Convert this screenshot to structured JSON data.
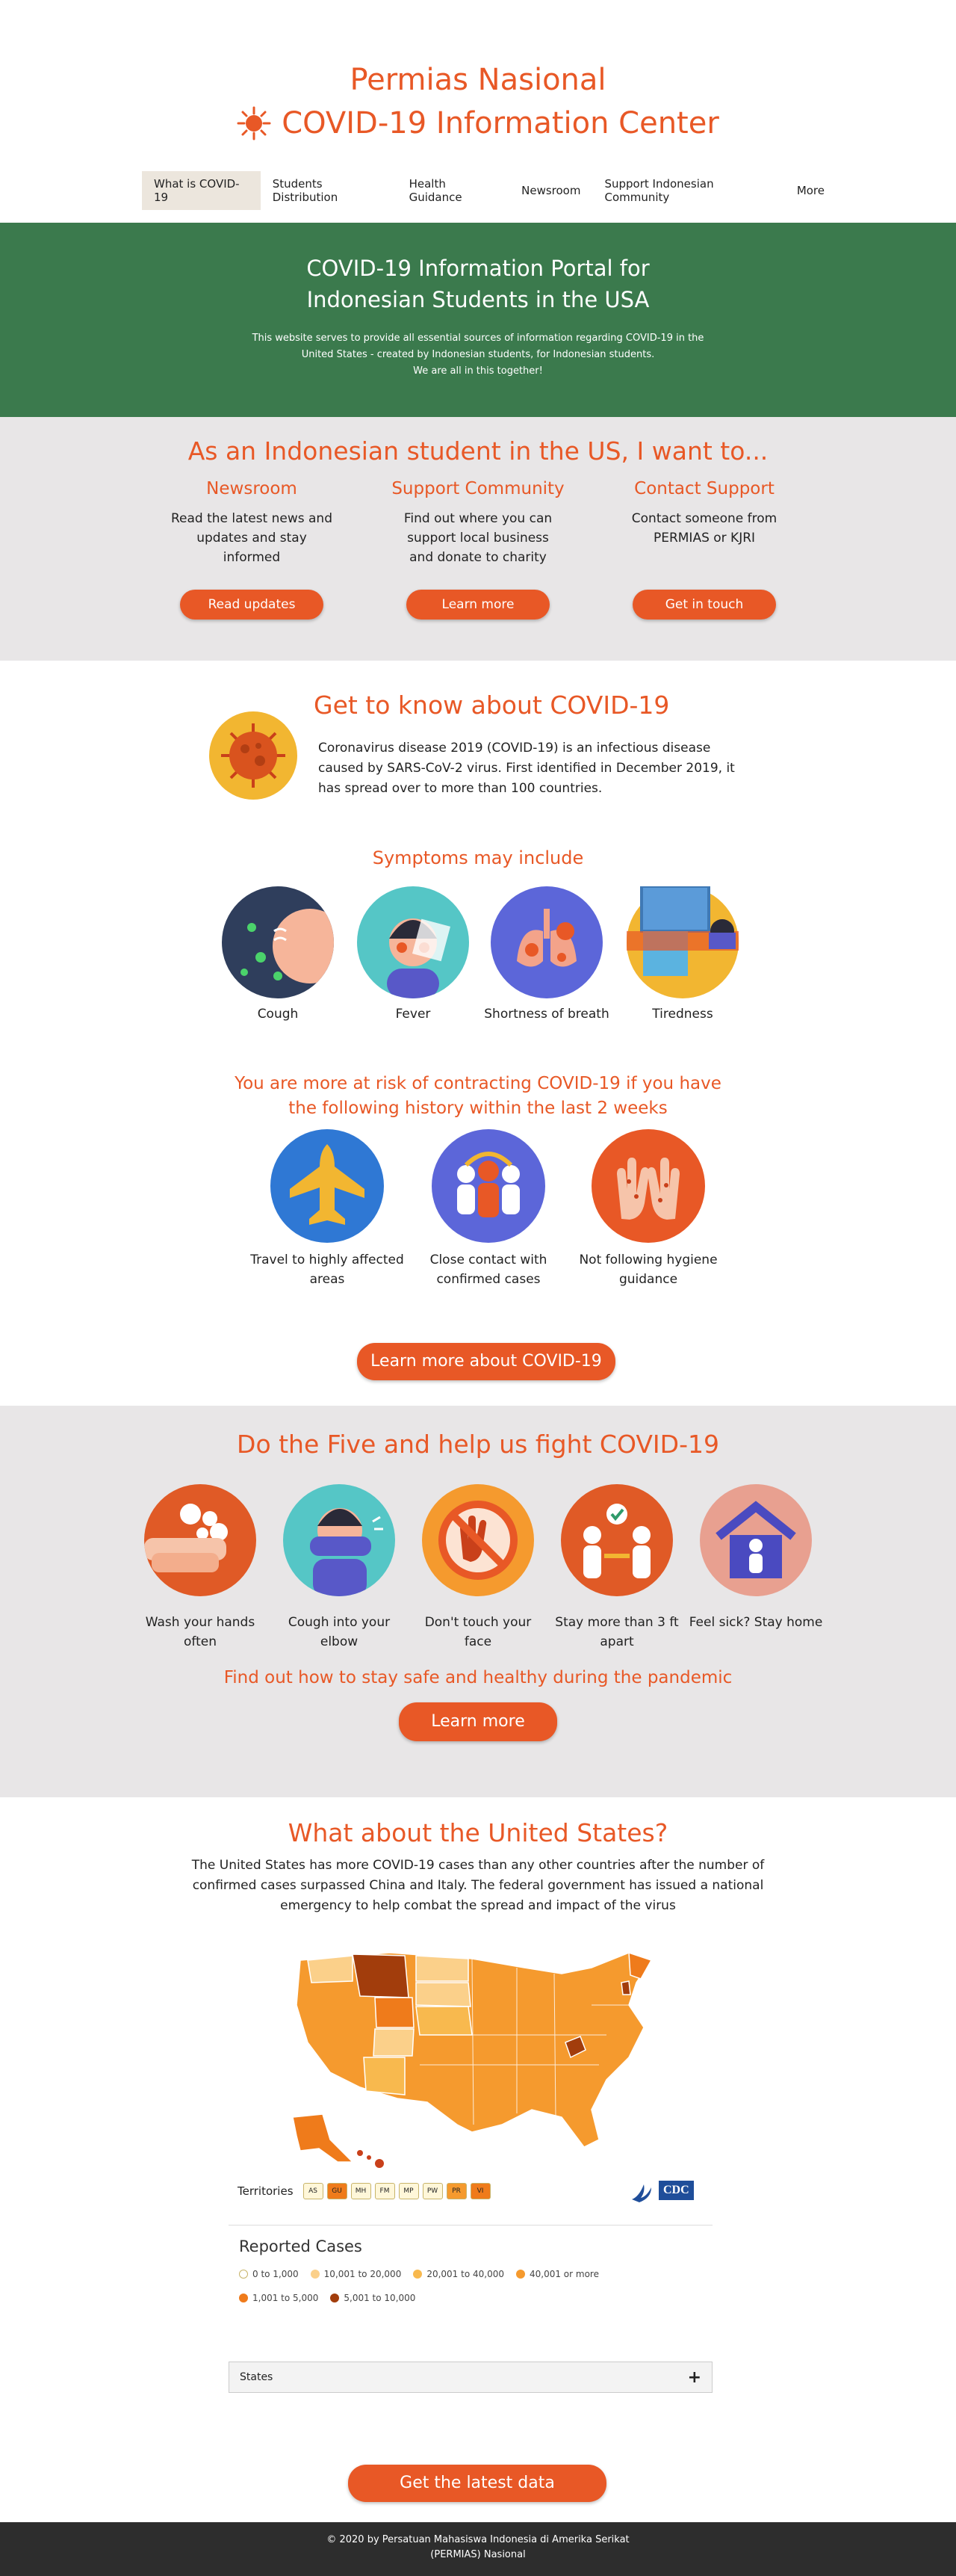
{
  "header": {
    "title_line1": "Permias Nasional",
    "title_line2": "COVID-19 Information Center",
    "nav": [
      {
        "label": "What is COVID-19"
      },
      {
        "label": "Students Distribution"
      },
      {
        "label": "Health Guidance"
      },
      {
        "label": "Newsroom"
      },
      {
        "label": "Support Indonesian Community"
      },
      {
        "label": "More"
      }
    ]
  },
  "hero": {
    "title_line1": "COVID-19 Information Portal for",
    "title_line2": "Indonesian Students in the USA",
    "text_line1": "This website serves to provide all essential sources of information regarding COVID-19 in the",
    "text_line2": "United States - created by Indonesian students, for Indonesian students.",
    "text_line3": "We are all in this together!"
  },
  "want": {
    "heading": "As an Indonesian student in the US, I want to...",
    "columns": [
      {
        "title": "Newsroom",
        "text": "Read the latest news and updates and stay informed",
        "button": "Read updates"
      },
      {
        "title": "Support Community",
        "text": "Find out where you can support local business and donate to charity",
        "button": "Learn more"
      },
      {
        "title": "Contact Support",
        "text": "Contact someone from PERMIAS or KJRI",
        "button": "Get in touch"
      }
    ]
  },
  "know": {
    "heading": "Get to know about COVID-19",
    "intro": "Coronavirus disease 2019 (COVID-19) is an infectious disease caused by SARS-CoV-2 virus. First identified in December 2019, it has spread over to more than 100 countries.",
    "symptoms_heading": "Symptoms may include",
    "symptoms": [
      {
        "label": "Cough",
        "icon": "cough-icon"
      },
      {
        "label": "Fever",
        "icon": "fever-icon"
      },
      {
        "label": "Shortness of breath",
        "icon": "lungs-icon"
      },
      {
        "label": "Tiredness",
        "icon": "tired-icon"
      }
    ],
    "risk_heading_line1": "You are more at risk of contracting COVID-19 if you have",
    "risk_heading_line2": "the following history within the last 2 weeks",
    "risks": [
      {
        "label": "Travel to highly affected areas",
        "icon": "airplane-icon"
      },
      {
        "label": "Close contact with confirmed cases",
        "icon": "people-icon"
      },
      {
        "label": "Not following hygiene guidance",
        "icon": "germs-hands-icon"
      }
    ],
    "button": "Learn more about COVID-19"
  },
  "five": {
    "heading": "Do the Five and help us fight COVID-19",
    "actions": [
      {
        "label": "Wash your hands often",
        "icon": "wash-hands-icon"
      },
      {
        "label": "Cough into your elbow",
        "icon": "elbow-cough-icon"
      },
      {
        "label": "Don't touch your face",
        "icon": "no-touch-icon"
      },
      {
        "label": "Stay more than 3 ft apart",
        "icon": "distance-icon"
      },
      {
        "label": "Feel sick? Stay home",
        "icon": "home-icon"
      }
    ],
    "subheading": "Find out how to stay safe and healthy during the pandemic",
    "button": "Learn more"
  },
  "us": {
    "heading": "What about the United States?",
    "desc": "The United States has more COVID-19 cases than any other countries after the number of confirmed cases surpassed China and Italy. The federal government has issued a national emergency to help combat the spread and impact of the virus",
    "territories_label": "Territories",
    "territories": [
      "AS",
      "GU",
      "MH",
      "FM",
      "MP",
      "PW",
      "PR",
      "VI"
    ],
    "cdc_label": "CDC",
    "reported_title": "Reported Cases",
    "legend": [
      {
        "label": "0 to 1,000",
        "color": "#ffffff"
      },
      {
        "label": "10,001 to 20,000",
        "color": "#fbd08a"
      },
      {
        "label": "20,001 to 40,000",
        "color": "#f8b94e"
      },
      {
        "label": "40,001 or more",
        "color": "#f59a2e"
      },
      {
        "label": "1,001 to 5,000",
        "color": "#ef7b1b"
      },
      {
        "label": "5,001 to 10,000",
        "color": "#a23d0c"
      }
    ],
    "states_label": "States",
    "states_toggle": "+",
    "button": "Get the latest data"
  },
  "footer": {
    "line1": "© 2020 by Persatuan Mahasiswa Indonesia di Amerika Serikat",
    "line2": "(PERMIAS) Nasional"
  }
}
